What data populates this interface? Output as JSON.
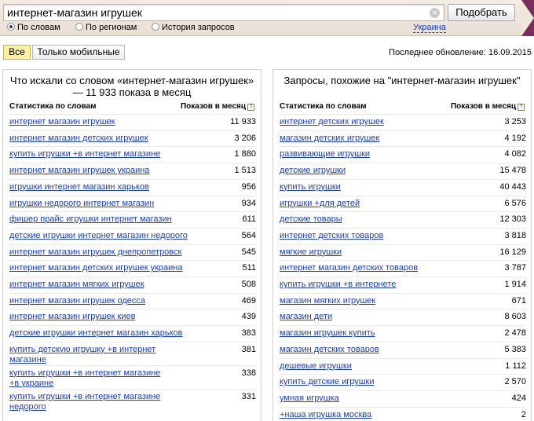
{
  "search": {
    "query": "интернет-магазин игрушек",
    "submit_label": "Подобрать",
    "clear_glyph": "×"
  },
  "modes": [
    {
      "label": "По словам",
      "selected": true
    },
    {
      "label": "По регионам",
      "selected": false
    },
    {
      "label": "История запросов",
      "selected": false
    }
  ],
  "region": "Украина",
  "filters": [
    {
      "label": "Все",
      "active": true
    },
    {
      "label": "Только мобильные",
      "active": false
    }
  ],
  "last_update": "Последнее обновление: 16.09.2015",
  "left_panel": {
    "title": "Что искали со словом «интернет-магазин игрушек» — 11 933 показа в месяц",
    "col_words": "Статистика по словам",
    "col_shows": "Показов в месяц",
    "rows": [
      {
        "q": "интернет магазин игрушек",
        "n": "11 933"
      },
      {
        "q": "интернет магазин детских игрушек",
        "n": "3 206"
      },
      {
        "q": "купить игрушки +в интернет магазине",
        "n": "1 880"
      },
      {
        "q": "интернет магазин игрушек украина",
        "n": "1 513"
      },
      {
        "q": "игрушки интернет магазин харьков",
        "n": "956"
      },
      {
        "q": "игрушки недорого интернет магазин",
        "n": "934"
      },
      {
        "q": "фишер прайс игрушки интернет магазин",
        "n": "611"
      },
      {
        "q": "детские игрушки интернет магазин недорого",
        "n": "564"
      },
      {
        "q": "интернет магазин игрушек днепропетровск",
        "n": "545"
      },
      {
        "q": "интернет магазин детских игрушек украина",
        "n": "511"
      },
      {
        "q": "интернет магазин мягких игрушек",
        "n": "508"
      },
      {
        "q": "интернет магазин игрушек одесса",
        "n": "469"
      },
      {
        "q": "интернет магазин игрушек киев",
        "n": "439"
      },
      {
        "q": "детские игрушки интернет магазин харьков",
        "n": "383"
      },
      {
        "q": "купить детскую игрушку +в интернет магазине",
        "n": "381"
      },
      {
        "q": "купить игрушки +в интернет магазине +в украине",
        "n": "338"
      },
      {
        "q": "купить игрушки +в интернет магазине недорого",
        "n": "331"
      }
    ]
  },
  "right_panel": {
    "title": "Запросы, похожие на \"интернет-магазин игрушек\"",
    "col_words": "Статистика по словам",
    "col_shows": "Показов в месяц",
    "rows": [
      {
        "q": "интернет детских игрушек",
        "n": "3 253"
      },
      {
        "q": "магазин детских игрушек",
        "n": "4 192"
      },
      {
        "q": "развивающие игрушки",
        "n": "4 082"
      },
      {
        "q": "детские игрушки",
        "n": "15 478"
      },
      {
        "q": "купить игрушки",
        "n": "40 443"
      },
      {
        "q": "игрушки +для детей",
        "n": "6 576"
      },
      {
        "q": "детские товары",
        "n": "12 303"
      },
      {
        "q": "интернет детских товаров",
        "n": "3 818"
      },
      {
        "q": "мягкие игрушки",
        "n": "16 129"
      },
      {
        "q": "интернет магазин детских товаров",
        "n": "3 787"
      },
      {
        "q": "купить игрушки +в интернете",
        "n": "1 914"
      },
      {
        "q": "магазин мягких игрушек",
        "n": "671"
      },
      {
        "q": "магазин дети",
        "n": "8 603"
      },
      {
        "q": "магазин игрушек купить",
        "n": "2 478"
      },
      {
        "q": "магазин детских товаров",
        "n": "5 383"
      },
      {
        "q": "дешевые игрушки",
        "n": "1 112"
      },
      {
        "q": "купить детские игрушки",
        "n": "2 570"
      },
      {
        "q": "умная игрушка",
        "n": "424"
      },
      {
        "q": "+наша игрушка москва",
        "n": "2"
      }
    ]
  },
  "colors": {
    "link": "#1a3dc1",
    "header_accent": "#7a2d5e",
    "active_filter": "#fbeea5"
  }
}
